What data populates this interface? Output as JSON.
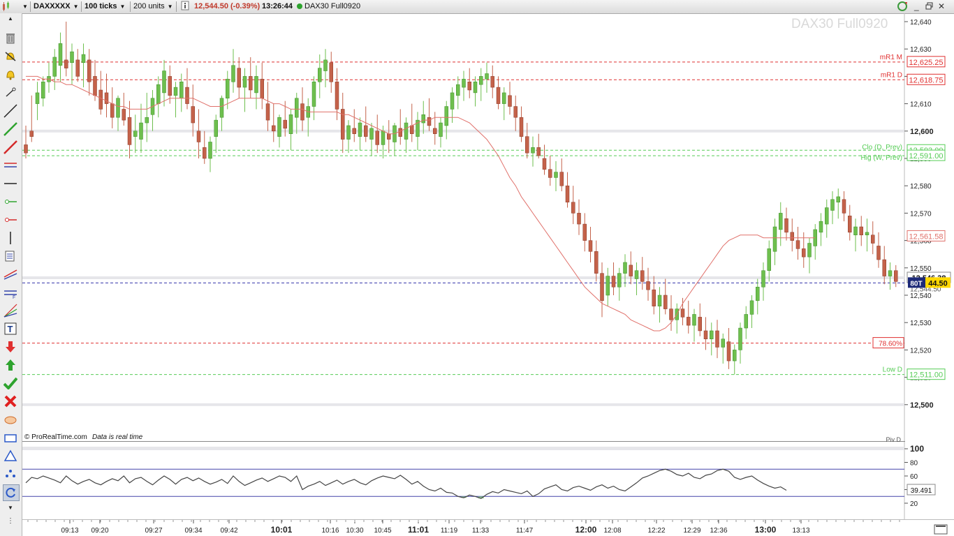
{
  "toolbar": {
    "instrument": "DAXXXXX",
    "ticks": "100 ticks",
    "units": "200 units",
    "price_change": "12,544.50 (-0.39%)",
    "time": "13:26:44",
    "chart_name": "DAX30 Full0920"
  },
  "watermark": "DAX30 Full0920",
  "footer": {
    "source": "© ProRealTime.com",
    "realtime": "Data is real time"
  },
  "colors": {
    "bull": "#6ebf4e",
    "bear": "#c4624a",
    "ma": "#e0706a",
    "price_tag": "#ffd800",
    "red_level": "#e03030",
    "green_level": "#55cc55",
    "blue_level": "#3333aa"
  },
  "icons": [
    "scroll-up-arrow-icon",
    "trash-icon",
    "alert-bell-icon",
    "bell-icon",
    "cursor-icon",
    "line-icon",
    "green-line-icon",
    "red-line-icon",
    "channel-icon",
    "horizontal-line-icon",
    "green-marker-icon",
    "red-marker-icon",
    "vertical-line-icon",
    "fibonacci-icon",
    "ray-icon",
    "fan-icon",
    "gann-icon",
    "text-icon",
    "sell-arrow-icon",
    "buy-arrow-icon",
    "checkmark-icon",
    "cross-icon",
    "ellipse-icon",
    "rectangle-icon",
    "triangle-icon",
    "star-icon",
    "reset-icon",
    "scroll-down-arrow-icon"
  ],
  "price_axis": {
    "ticks": [
      "12,640",
      "12,630",
      "12,620",
      "12,610",
      "12,600",
      "12,590",
      "12,580",
      "12,570",
      "12,560",
      "12,550",
      "12,540",
      "12,530",
      "12,520",
      "12,510",
      "12,500"
    ],
    "bold_ticks": [
      "12,600",
      "12,500"
    ]
  },
  "levels": [
    {
      "label": "mR1 M",
      "value": "12,625.25",
      "price": 12625.25,
      "kind": "red"
    },
    {
      "label": "mR1 D",
      "value": "12,618.75",
      "price": 12618.75,
      "kind": "red"
    },
    {
      "label": "Clo (D, Prev)",
      "value": "12,593.00",
      "price": 12593.0,
      "kind": "green"
    },
    {
      "label": "Hig (W, Prev)",
      "value": "12,591.00",
      "price": 12591.0,
      "kind": "green"
    },
    {
      "label": "78.60%",
      "value": "",
      "price": 12522.5,
      "kind": "red"
    },
    {
      "label": "Low D",
      "value": "12,511.00",
      "price": 12511.0,
      "kind": "green"
    }
  ],
  "ma_value": "12,561.58",
  "current_price": {
    "value": "12,546.38",
    "price": 12546.38
  },
  "position": {
    "label": "80T",
    "value": "44.50",
    "price": 12544.5,
    "value_behind": "12,544.50"
  },
  "time_axis": {
    "labels": [
      "09:13",
      "09:20",
      "09:27",
      "09:34",
      "09:42",
      "10:01",
      "10:16",
      "10:30",
      "10:45",
      "11:01",
      "11:19",
      "11:33",
      "11:47",
      "12:00",
      "12:08",
      "12:22",
      "12:29",
      "12:36",
      "13:00",
      "13:13"
    ],
    "bold": [
      "10:01",
      "11:01",
      "12:00",
      "13:00"
    ]
  },
  "indicator": {
    "ticks": [
      "100",
      "80",
      "60",
      "40",
      "20"
    ],
    "value": "39.491",
    "upper": 70,
    "lower": 30,
    "cut_label": "Piv D"
  },
  "chart_data": {
    "type": "candlestick",
    "ylim": [
      12490,
      12645
    ],
    "candles": [
      [
        12595,
        12602,
        12590,
        12592
      ],
      [
        12600,
        12613,
        12596,
        12598
      ],
      [
        12610,
        12618,
        12604,
        12614
      ],
      [
        12612,
        12620,
        12609,
        12618
      ],
      [
        12618,
        12625,
        12614,
        12620
      ],
      [
        12620,
        12630,
        12615,
        12627
      ],
      [
        12624,
        12636,
        12618,
        12632
      ],
      [
        12626,
        12640,
        12620,
        12623
      ],
      [
        12625,
        12632,
        12617,
        12629
      ],
      [
        12626,
        12630,
        12618,
        12620
      ],
      [
        12625,
        12632,
        12616,
        12628
      ],
      [
        12626,
        12630,
        12613,
        12618
      ],
      [
        12620,
        12626,
        12611,
        12613
      ],
      [
        12615,
        12622,
        12606,
        12608
      ],
      [
        12614,
        12621,
        12605,
        12610
      ],
      [
        12610,
        12616,
        12601,
        12605
      ],
      [
        12605,
        12613,
        12600,
        12612
      ],
      [
        12608,
        12614,
        12602,
        12604
      ],
      [
        12605,
        12611,
        12590,
        12595
      ],
      [
        12598,
        12606,
        12592,
        12600
      ],
      [
        12597,
        12610,
        12592,
        12603
      ],
      [
        12603,
        12614,
        12596,
        12605
      ],
      [
        12606,
        12615,
        12600,
        12612
      ],
      [
        12610,
        12620,
        12605,
        12617
      ],
      [
        12614,
        12626,
        12609,
        12622
      ],
      [
        12620,
        12624,
        12610,
        12613
      ],
      [
        12613,
        12618,
        12605,
        12616
      ],
      [
        12612,
        12621,
        12607,
        12618
      ],
      [
        12616,
        12623,
        12608,
        12610
      ],
      [
        12609,
        12617,
        12598,
        12603
      ],
      [
        12600,
        12608,
        12590,
        12596
      ],
      [
        12594,
        12600,
        12588,
        12590
      ],
      [
        12590,
        12598,
        12585,
        12596
      ],
      [
        12598,
        12606,
        12592,
        12604
      ],
      [
        12605,
        12613,
        12600,
        12612
      ],
      [
        12612,
        12622,
        12608,
        12619
      ],
      [
        12618,
        12630,
        12614,
        12624
      ],
      [
        12623,
        12627,
        12612,
        12616
      ],
      [
        12616,
        12623,
        12607,
        12620
      ],
      [
        12620,
        12627,
        12612,
        12615
      ],
      [
        12614,
        12624,
        12608,
        12620
      ],
      [
        12619,
        12625,
        12608,
        12612
      ],
      [
        12610,
        12618,
        12600,
        12604
      ],
      [
        12602,
        12610,
        12596,
        12600
      ],
      [
        12598,
        12606,
        12594,
        12605
      ],
      [
        12604,
        12611,
        12598,
        12601
      ],
      [
        12599,
        12608,
        12593,
        12606
      ],
      [
        12605,
        12614,
        12599,
        12612
      ],
      [
        12610,
        12616,
        12600,
        12604
      ],
      [
        12605,
        12612,
        12598,
        12609
      ],
      [
        12609,
        12620,
        12604,
        12618
      ],
      [
        12618,
        12628,
        12612,
        12623
      ],
      [
        12622,
        12630,
        12616,
        12626
      ],
      [
        12625,
        12629,
        12614,
        12618
      ],
      [
        12618,
        12623,
        12604,
        12608
      ],
      [
        12608,
        12614,
        12592,
        12597
      ],
      [
        12597,
        12604,
        12592,
        12602
      ],
      [
        12601,
        12608,
        12596,
        12599
      ],
      [
        12598,
        12605,
        12593,
        12603
      ],
      [
        12602,
        12609,
        12596,
        12598
      ],
      [
        12597,
        12603,
        12591,
        12601
      ],
      [
        12600,
        12606,
        12592,
        12595
      ],
      [
        12595,
        12602,
        12590,
        12600
      ],
      [
        12599,
        12604,
        12592,
        12597
      ],
      [
        12596,
        12603,
        12591,
        12602
      ],
      [
        12601,
        12608,
        12595,
        12598
      ],
      [
        12597,
        12605,
        12592,
        12603
      ],
      [
        12602,
        12610,
        12596,
        12599
      ],
      [
        12598,
        12607,
        12593,
        12604
      ],
      [
        12603,
        12611,
        12599,
        12606
      ],
      [
        12605,
        12612,
        12600,
        12602
      ],
      [
        12601,
        12607,
        12595,
        12599
      ],
      [
        12598,
        12605,
        12594,
        12603
      ],
      [
        12602,
        12611,
        12597,
        12609
      ],
      [
        12608,
        12616,
        12603,
        12614
      ],
      [
        12613,
        12620,
        12608,
        12617
      ],
      [
        12616,
        12622,
        12611,
        12619
      ],
      [
        12618,
        12623,
        12612,
        12615
      ],
      [
        12614,
        12620,
        12609,
        12618
      ],
      [
        12617,
        12623,
        12611,
        12620
      ],
      [
        12619,
        12625,
        12614,
        12621
      ],
      [
        12620,
        12624,
        12612,
        12616
      ],
      [
        12616,
        12620,
        12608,
        12610
      ],
      [
        12610,
        12616,
        12604,
        12614
      ],
      [
        12613,
        12618,
        12606,
        12609
      ],
      [
        12609,
        12613,
        12600,
        12605
      ],
      [
        12605,
        12609,
        12596,
        12598
      ],
      [
        12598,
        12603,
        12590,
        12592
      ],
      [
        12592,
        12598,
        12587,
        12594
      ],
      [
        12594,
        12599,
        12590,
        12591
      ],
      [
        12590,
        12595,
        12584,
        12586
      ],
      [
        12586,
        12591,
        12580,
        12583
      ],
      [
        12583,
        12589,
        12578,
        12585
      ],
      [
        12585,
        12590,
        12578,
        12580
      ],
      [
        12580,
        12585,
        12572,
        12574
      ],
      [
        12574,
        12580,
        12566,
        12570
      ],
      [
        12570,
        12575,
        12562,
        12566
      ],
      [
        12566,
        12570,
        12556,
        12560
      ],
      [
        12560,
        12565,
        12552,
        12556
      ],
      [
        12556,
        12560,
        12545,
        12548
      ],
      [
        12548,
        12552,
        12532,
        12538
      ],
      [
        12540,
        12550,
        12536,
        12547
      ],
      [
        12547,
        12552,
        12540,
        12543
      ],
      [
        12543,
        12550,
        12538,
        12548
      ],
      [
        12548,
        12555,
        12543,
        12552
      ],
      [
        12551,
        12556,
        12544,
        12547
      ],
      [
        12546,
        12552,
        12540,
        12549
      ],
      [
        12549,
        12554,
        12542,
        12545
      ],
      [
        12545,
        12550,
        12538,
        12542
      ],
      [
        12542,
        12547,
        12533,
        12536
      ],
      [
        12536,
        12543,
        12530,
        12540
      ],
      [
        12540,
        12546,
        12533,
        12535
      ],
      [
        12535,
        12540,
        12527,
        12531
      ],
      [
        12531,
        12537,
        12526,
        12535
      ],
      [
        12535,
        12539,
        12529,
        12532
      ],
      [
        12532,
        12538,
        12526,
        12529
      ],
      [
        12529,
        12535,
        12523,
        12533
      ],
      [
        12532,
        12537,
        12525,
        12527
      ],
      [
        12527,
        12532,
        12520,
        12524
      ],
      [
        12524,
        12530,
        12518,
        12527
      ],
      [
        12527,
        12531,
        12517,
        12521
      ],
      [
        12521,
        12526,
        12515,
        12524
      ],
      [
        12523,
        12528,
        12513,
        12516
      ],
      [
        12516,
        12522,
        12511,
        12520
      ],
      [
        12520,
        12530,
        12515,
        12528
      ],
      [
        12528,
        12536,
        12524,
        12533
      ],
      [
        12533,
        12540,
        12528,
        12538
      ],
      [
        12538,
        12546,
        12533,
        12543
      ],
      [
        12543,
        12552,
        12538,
        12549
      ],
      [
        12549,
        12560,
        12545,
        12557
      ],
      [
        12556,
        12568,
        12551,
        12565
      ],
      [
        12564,
        12574,
        12558,
        12570
      ],
      [
        12568,
        12572,
        12560,
        12563
      ],
      [
        12563,
        12568,
        12556,
        12560
      ],
      [
        12560,
        12565,
        12553,
        12557
      ],
      [
        12557,
        12563,
        12550,
        12554
      ],
      [
        12554,
        12561,
        12548,
        12559
      ],
      [
        12558,
        12566,
        12553,
        12564
      ],
      [
        12563,
        12570,
        12558,
        12567
      ],
      [
        12566,
        12575,
        12561,
        12572
      ],
      [
        12571,
        12578,
        12566,
        12575
      ],
      [
        12574,
        12579,
        12568,
        12576
      ],
      [
        12575,
        12578,
        12567,
        12570
      ],
      [
        12569,
        12573,
        12560,
        12563
      ],
      [
        12562,
        12568,
        12556,
        12565
      ],
      [
        12565,
        12569,
        12558,
        12562
      ],
      [
        12562,
        12568,
        12556,
        12563
      ],
      [
        12562,
        12567,
        12555,
        12559
      ],
      [
        12558,
        12563,
        12550,
        12553
      ],
      [
        12553,
        12558,
        12544,
        12547
      ],
      [
        12547,
        12552,
        12542,
        12549
      ],
      [
        12549,
        12551,
        12543,
        12545
      ]
    ],
    "moving_average": [
      12620,
      12620,
      12620,
      12619,
      12619,
      12618,
      12618,
      12617,
      12617,
      12616,
      12615,
      12614,
      12613,
      12612,
      12611,
      12610,
      12609,
      12609,
      12608,
      12608,
      12608,
      12608,
      12609,
      12610,
      12611,
      12612,
      12612,
      12612,
      12612,
      12612,
      12611,
      12610,
      12609,
      12609,
      12609,
      12610,
      12611,
      12612,
      12612,
      12612,
      12612,
      12612,
      12611,
      12610,
      12610,
      12609,
      12608,
      12608,
      12608,
      12607,
      12607,
      12607,
      12607,
      12607,
      12607,
      12606,
      12606,
      12605,
      12604,
      12603,
      12602,
      12601,
      12600,
      12599,
      12599,
      12600,
      12601,
      12602,
      12603,
      12604,
      12604,
      12605,
      12605,
      12605,
      12605,
      12605,
      12604,
      12603,
      12601,
      12599,
      12597,
      12594,
      12591,
      12587,
      12583,
      12580,
      12576,
      12573,
      12570,
      12567,
      12564,
      12561,
      12558,
      12555,
      12552,
      12549,
      12546,
      12543,
      12541,
      12539,
      12537,
      12536,
      12535,
      12534,
      12533,
      12531,
      12530,
      12529,
      12528,
      12527,
      12527,
      12528,
      12530,
      12533,
      12537,
      12540,
      12543,
      12546,
      12549,
      12552,
      12555,
      12558,
      12560,
      12561,
      12562,
      12562,
      12562,
      12562,
      12561,
      12561,
      12561,
      12561,
      12561,
      12561,
      12561,
      12561,
      12561,
      12561
    ],
    "oscillator": [
      50,
      58,
      56,
      60,
      57,
      54,
      50,
      60,
      53,
      48,
      52,
      55,
      50,
      47,
      52,
      56,
      53,
      60,
      50,
      56,
      58,
      52,
      47,
      54,
      60,
      55,
      48,
      55,
      58,
      53,
      57,
      52,
      48,
      51,
      55,
      49,
      60,
      52,
      46,
      50,
      54,
      57,
      52,
      56,
      60,
      58,
      52,
      60,
      40,
      45,
      48,
      52,
      46,
      50,
      54,
      48,
      52,
      55,
      50,
      47,
      53,
      57,
      60,
      58,
      56,
      61,
      55,
      48,
      52,
      45,
      40,
      38,
      42,
      36,
      35,
      30,
      28,
      32,
      30,
      27,
      33,
      37,
      35,
      40,
      38,
      36,
      34,
      38,
      30,
      34,
      41,
      44,
      47,
      40,
      38,
      43,
      45,
      42,
      39,
      44,
      47,
      42,
      45,
      40,
      38,
      44,
      50,
      57,
      60,
      64,
      68,
      70,
      67,
      62,
      60,
      64,
      58,
      56,
      61,
      63,
      68,
      70,
      67,
      58,
      55,
      58,
      60,
      54,
      49,
      45,
      42,
      44,
      39
    ]
  }
}
